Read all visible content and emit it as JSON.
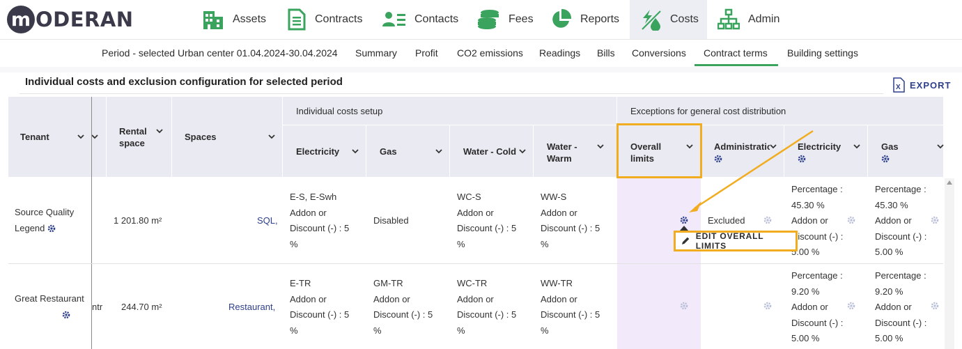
{
  "logo": {
    "badge": "m",
    "text": "ODERAN"
  },
  "nav": [
    {
      "label": "Assets",
      "icon": "building-icon"
    },
    {
      "label": "Contracts",
      "icon": "document-icon"
    },
    {
      "label": "Contacts",
      "icon": "contacts-icon"
    },
    {
      "label": "Fees",
      "icon": "coins-icon"
    },
    {
      "label": "Reports",
      "icon": "pie-chart-icon"
    },
    {
      "label": "Costs",
      "icon": "energy-water-icon",
      "active": true
    },
    {
      "label": "Admin",
      "icon": "org-chart-icon"
    }
  ],
  "subnav": {
    "period": "Period - selected Urban center 01.04.2024-30.04.2024",
    "items": [
      "Summary",
      "Profit",
      "CO2 emissions",
      "Readings",
      "Bills",
      "Conversions",
      "Contract terms",
      "Building settings"
    ],
    "active": "Contract terms"
  },
  "page": {
    "title": "Individual costs and exclusion configuration for selected period",
    "export_label": "EXPORT"
  },
  "table": {
    "headers": {
      "tenant": "Tenant",
      "rental_space": "Rental space",
      "spaces": "Spaces",
      "group_individual": "Individual costs setup",
      "group_exceptions": "Exceptions for general cost distribution",
      "electricity": "Electricity",
      "gas": "Gas",
      "water_cold": "Water - Cold",
      "water_warm": "Water - Warm",
      "overall_limits": "Overall limits",
      "administration": "Administratio",
      "exc_electricity": "Electricity",
      "exc_gas": "Gas"
    },
    "rows": [
      {
        "tenant": "Source Quality Legend",
        "rental_space": "1 201.80 m²",
        "spaces": "SQL,",
        "electricity": [
          "E-S, E-Swh",
          "Addon or",
          "Discount (-) : 5",
          "%"
        ],
        "gas": "Disabled",
        "water_cold": [
          "WC-S",
          "Addon or",
          "Discount (-) : 5",
          "%"
        ],
        "water_warm": [
          "WW-S",
          "Addon or",
          "Discount (-) : 5",
          "%"
        ],
        "administration": "Excluded",
        "exc_electricity": [
          "Percentage :",
          "45.30 %",
          "Addon or",
          "Discount (-) :",
          "5.00 %"
        ],
        "exc_gas": [
          "Percentage :",
          "45.30 %",
          "Addon or",
          "Discount (-) :",
          "5.00 %"
        ]
      },
      {
        "tenant": "Great Restaurant",
        "hidden_col": "ntr",
        "rental_space": "244.70 m²",
        "spaces": "Restaurant,",
        "electricity": [
          "E-TR",
          "Addon or",
          "Discount (-) : 5",
          "%"
        ],
        "gas": [
          "GM-TR",
          "Addon or",
          "Discount (-) : 5",
          "%"
        ],
        "water_cold": [
          "WC-TR",
          "Addon or",
          "Discount (-) : 5",
          "%"
        ],
        "water_warm": [
          "WW-TR",
          "Addon or",
          "Discount (-) : 5",
          "%"
        ],
        "exc_electricity": [
          "Percentage :",
          "9.20 %",
          "Addon or",
          "Discount (-) :",
          "5.00 %"
        ],
        "exc_gas": [
          "Percentage :",
          "9.20 %",
          "Addon or",
          "Discount (-) :",
          "5.00 %"
        ]
      }
    ]
  },
  "tooltip": {
    "label": "EDIT OVERALL LIMITS"
  },
  "colors": {
    "accent_green": "#3aa35e",
    "link_blue": "#2d3f8a",
    "highlight": "#f2ac1f",
    "header_bg": "#e9eaf2"
  }
}
